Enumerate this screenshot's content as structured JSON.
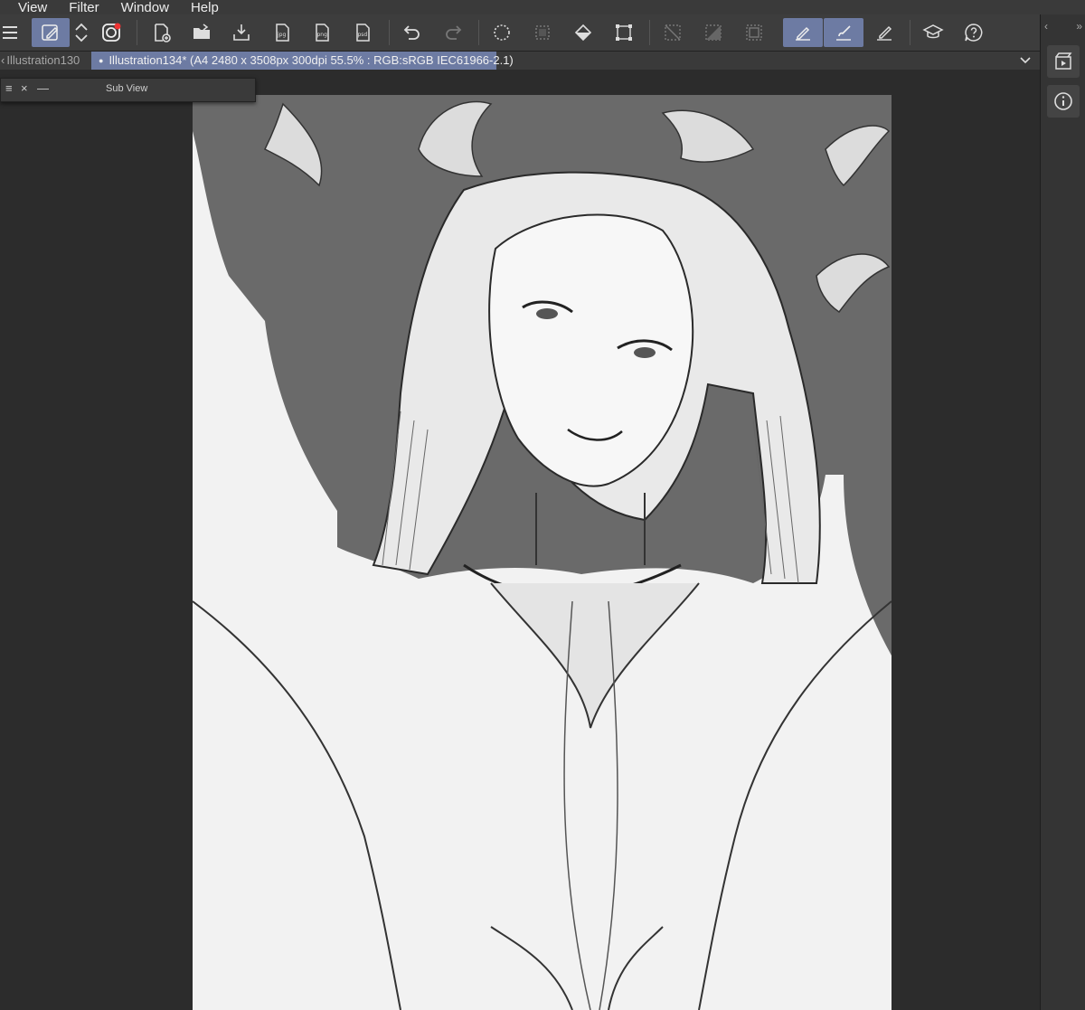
{
  "menu": {
    "items": [
      "View",
      "Filter",
      "Window",
      "Help"
    ]
  },
  "toolbar": {
    "icons": [
      "hamburger-icon",
      "pen-select-icon",
      "up-down-icon",
      "clip-studio-icon",
      "new-file-icon",
      "open-folder-icon",
      "save-icon",
      "export-jpg-icon",
      "export-png-icon",
      "export-psd-icon",
      "undo-icon",
      "redo-icon",
      "select-all-icon",
      "deselect-icon",
      "fill-icon",
      "transform-icon",
      "hide-selection-icon",
      "invert-selection-icon",
      "selection-border-icon",
      "pen-icon",
      "brush-icon",
      "pencil-icon",
      "learn-icon",
      "help-icon"
    ],
    "labels": {
      "jpg": "jpg",
      "png": "png",
      "psd": "psd"
    }
  },
  "tabs": {
    "inactive": "Illustration130",
    "active": "Illustration134* (A4 2480 x 3508px 300dpi 55.5% : RGB:sRGB IEC61966-2.1)"
  },
  "subview": {
    "title": "Sub View"
  },
  "colors": {
    "accent": "#6d7ba3",
    "background": "#2c2c2c",
    "paper_bg": "#6a6a6a"
  }
}
